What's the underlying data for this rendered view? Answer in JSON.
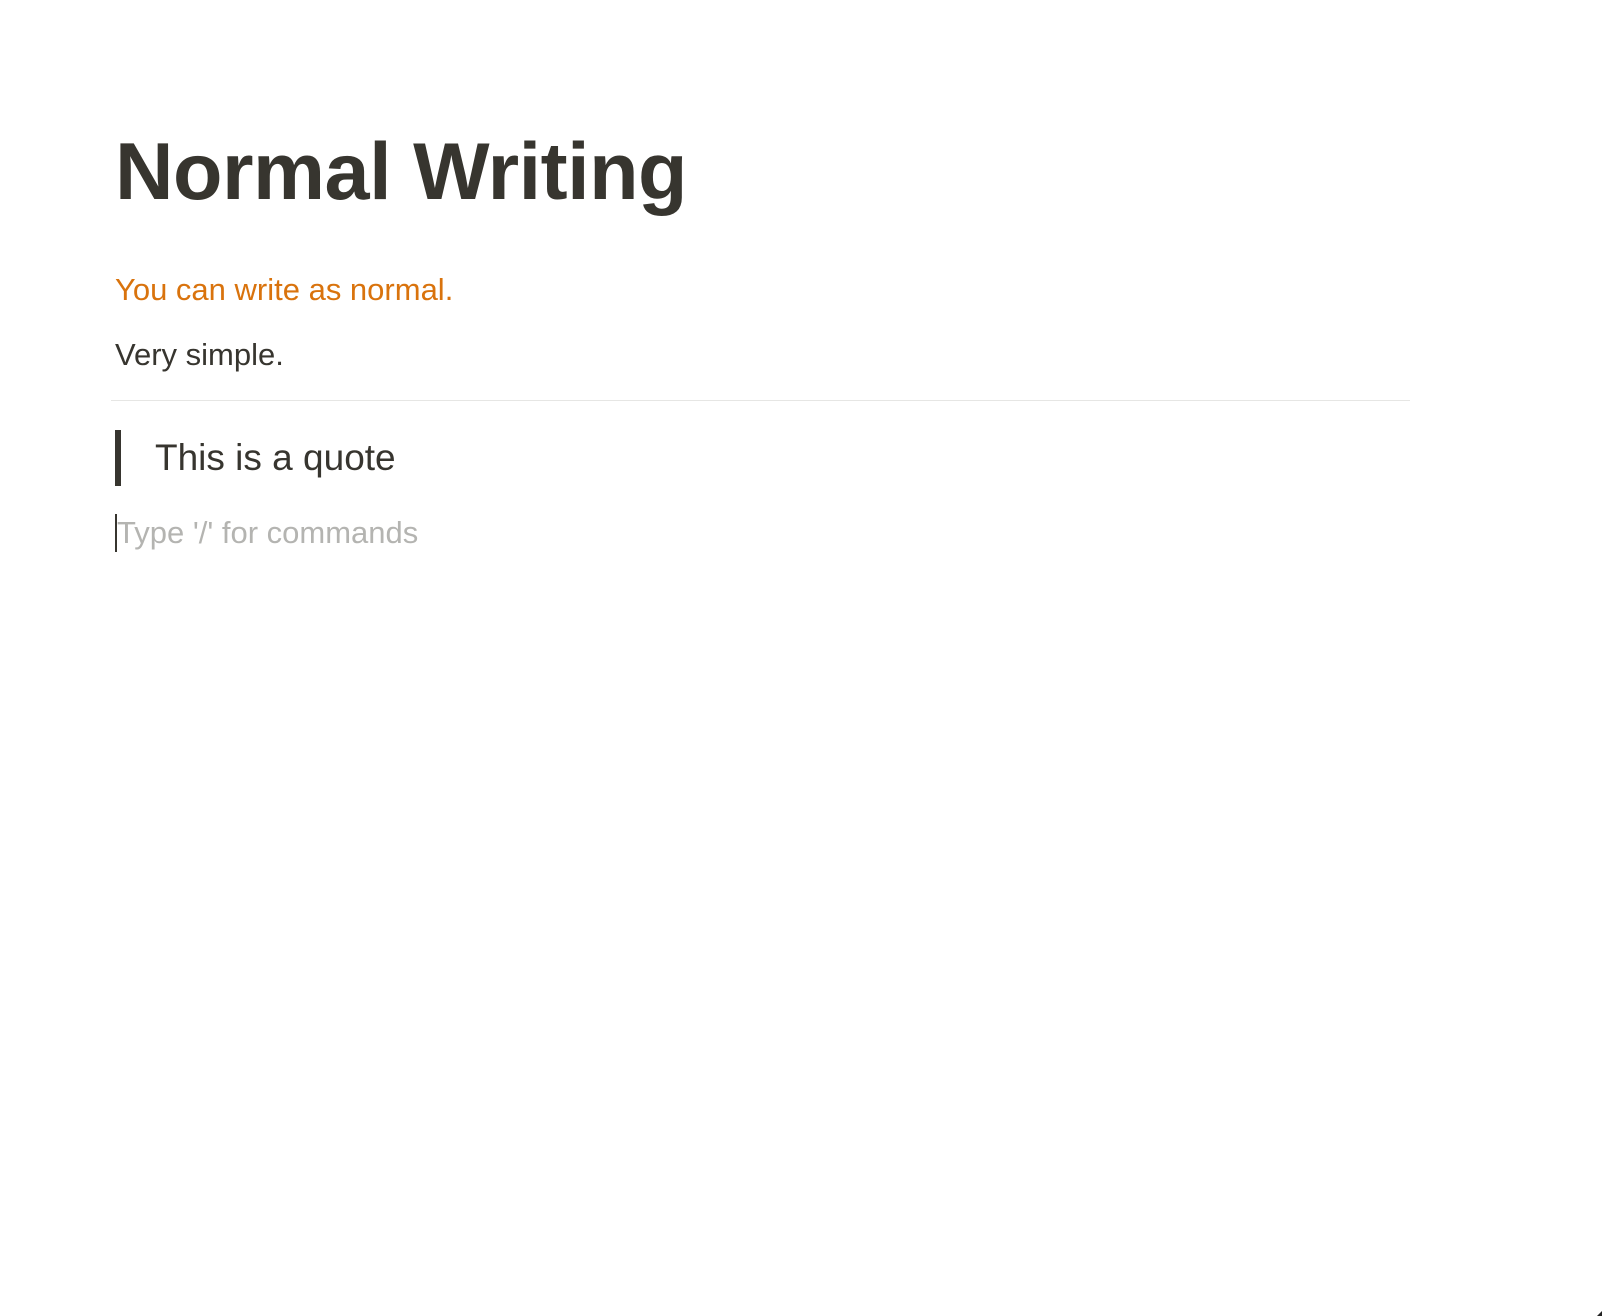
{
  "page": {
    "title": "Normal Writing"
  },
  "blocks": {
    "colored_text": "You can write as normal.",
    "plain_text": "Very simple.",
    "quote_text": "This is a quote",
    "empty_placeholder": "Type '/' for commands"
  },
  "colors": {
    "text": "#37352f",
    "orange_text": "#d9730d",
    "placeholder": "#b4b4b1",
    "divider": "#e6e6e4",
    "background": "#ffffff"
  },
  "icons": {
    "resize_handle": "resize-corner-icon"
  }
}
